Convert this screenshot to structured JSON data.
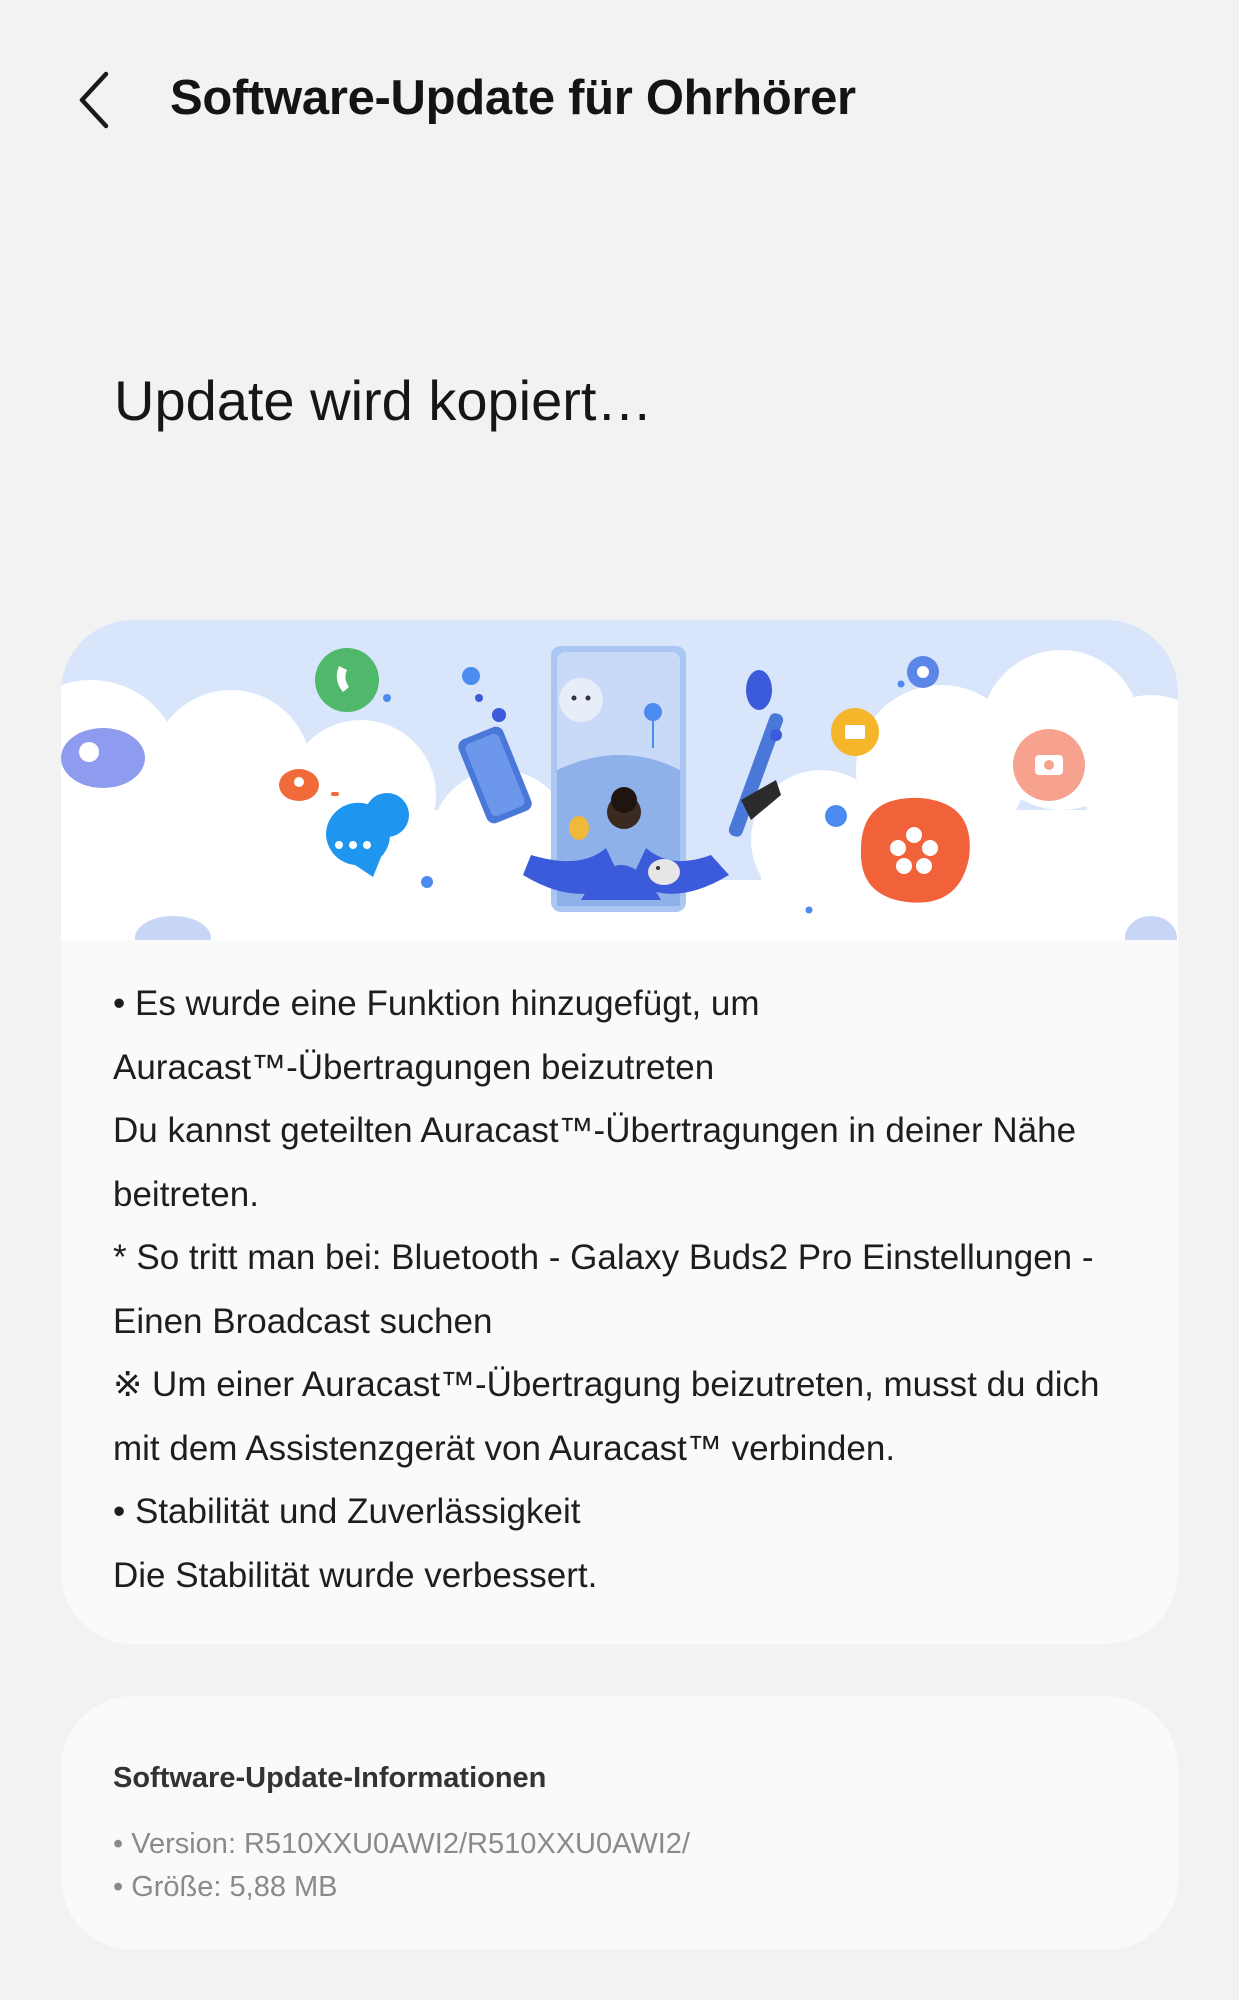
{
  "header": {
    "title": "Software-Update für Ohrhörer",
    "back_icon": "chevron-left-icon"
  },
  "status": {
    "text": "Update wird kopiert…"
  },
  "release_notes": {
    "illustration": "galaxy-ecosystem-illustration",
    "lines": [
      "• Es wurde eine Funktion hinzugefügt, um",
      "Auracast™-Übertragungen beizutreten",
      "Du kannst geteilten Auracast™-Übertragungen in deiner Nähe",
      "beitreten.",
      "* So tritt man bei: Bluetooth - Galaxy Buds2 Pro Einstellungen -",
      "Einen Broadcast suchen",
      "※ Um einer Auracast™-Übertragung beizutreten, musst du dich",
      "mit dem Assistenzgerät von Auracast™ verbinden.",
      "• Stabilität und Zuverlässigkeit",
      "Die Stabilität wurde verbessert."
    ]
  },
  "update_info": {
    "title": "Software-Update-Informationen",
    "version": "• Version: R510XXU0AWI2/R510XXU0AWI2/",
    "size": "• Größe: 5,88 MB"
  },
  "colors": {
    "background": "#f2f2f2",
    "card": "#fafafa",
    "accent_blue": "#3b5bdb",
    "sky": "#d7e4fb"
  }
}
